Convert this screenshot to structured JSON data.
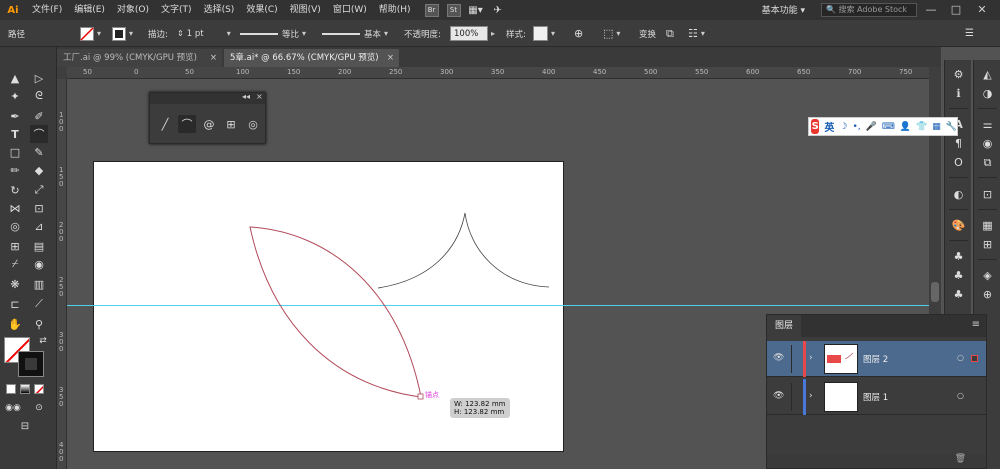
{
  "app": {
    "logo": "Ai"
  },
  "menubar": {
    "items": [
      "文件(F)",
      "编辑(E)",
      "对象(O)",
      "文字(T)",
      "选择(S)",
      "效果(C)",
      "视图(V)",
      "窗口(W)",
      "帮助(H)"
    ],
    "bridge": "Br",
    "stock": "St",
    "workspace": "基本功能",
    "search_placeholder": "搜索 Adobe Stock"
  },
  "controlbar": {
    "object_type": "路径",
    "stroke_label": "描边:",
    "stroke_weight": "1 pt",
    "profile_label": "等比",
    "brush_label": "基本",
    "opacity_label": "不透明度:",
    "opacity_value": "100%",
    "style_label": "样式:",
    "transform_label": "变换"
  },
  "tabs": [
    {
      "label": "工厂.ai @ 99% (CMYK/GPU 预览)",
      "close": "×"
    },
    {
      "label": "5章.ai* @ 66.67% (CMYK/GPU 预览)",
      "close": "×"
    }
  ],
  "ruler": {
    "h_ticks": [
      "50",
      "0",
      "50",
      "100",
      "150",
      "200",
      "250",
      "300",
      "350",
      "400",
      "450",
      "500",
      "550",
      "600",
      "650",
      "700",
      "750"
    ],
    "v_ticks": [
      "1\n0\n0",
      "1\n5\n0",
      "2\n0\n0",
      "2\n5\n0",
      "3\n0\n0",
      "3\n5\n0",
      "4\n0\n0"
    ]
  },
  "float_panel": {
    "collapse": "◂◂",
    "close": "×"
  },
  "ime": {
    "brand": "S",
    "lang": "英",
    "icons": [
      "☽",
      "•,",
      "🎤",
      "⌨",
      "👤",
      "👕",
      "▦",
      "🔧"
    ]
  },
  "tooltip": {
    "anchor": "锚点",
    "width": "W: 123.82 mm",
    "height": "H: 123.82 mm"
  },
  "layers_panel": {
    "title": "图层",
    "layers": [
      {
        "name": "图层 2",
        "color": "#e84848",
        "selected": true
      },
      {
        "name": "图层 1",
        "color": "#4a78d8",
        "selected": false
      }
    ]
  },
  "colors": {
    "guide": "#4fd3e8",
    "path_red": "#b24a5a",
    "layer_sel": "#4c6a8e"
  }
}
